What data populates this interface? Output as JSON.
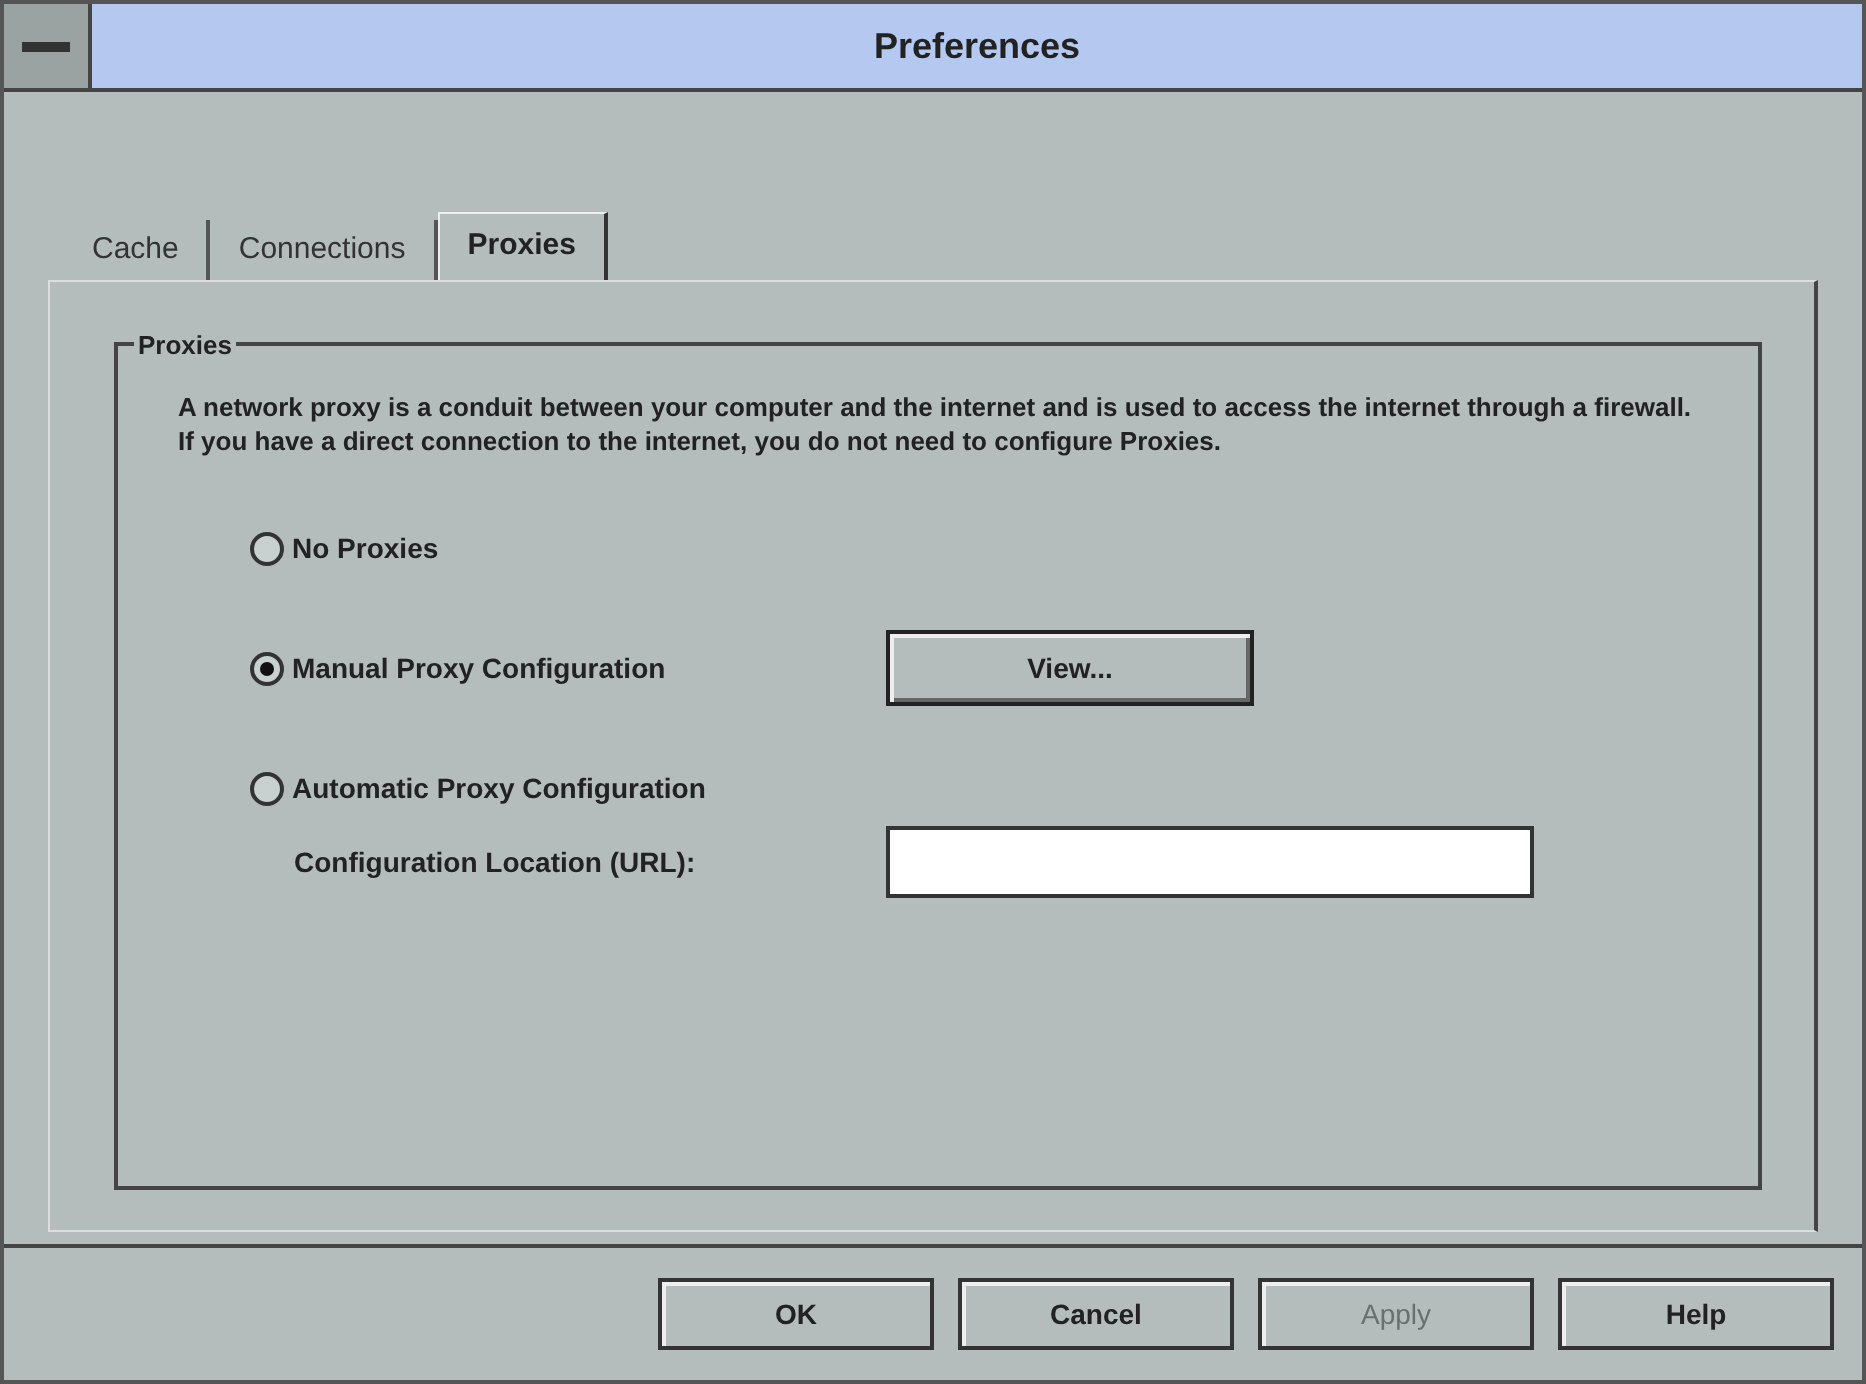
{
  "window": {
    "title": "Preferences"
  },
  "tabs": [
    {
      "label": "Cache",
      "selected": false
    },
    {
      "label": "Connections",
      "selected": false
    },
    {
      "label": "Proxies",
      "selected": true
    }
  ],
  "group": {
    "title": "Proxies",
    "description": "A network proxy is a conduit between your computer and the internet and is used to access the internet through a firewall.  If you have a direct connection to the internet, you do not need to configure Proxies."
  },
  "options": [
    {
      "label": "No Proxies",
      "selected": false
    },
    {
      "label": "Manual Proxy Configuration",
      "selected": true,
      "button": "View..."
    },
    {
      "label": "Automatic Proxy Configuration",
      "selected": false,
      "field_label": "Configuration Location (URL):"
    }
  ],
  "buttons": [
    {
      "label": "OK",
      "disabled": false
    },
    {
      "label": "Cancel",
      "disabled": false
    },
    {
      "label": "Apply",
      "disabled": true
    },
    {
      "label": "Help",
      "disabled": false
    }
  ]
}
